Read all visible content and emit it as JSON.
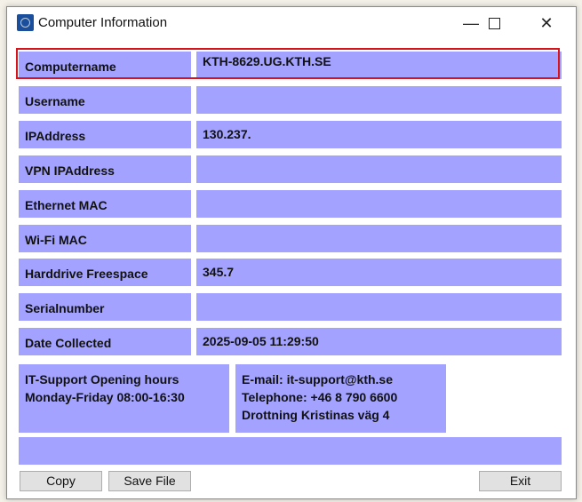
{
  "window": {
    "title": "Computer Information"
  },
  "fields": [
    {
      "label": "Computername",
      "value": "KTH-8629.UG.KTH.SE"
    },
    {
      "label": "Username",
      "value": ""
    },
    {
      "label": "IPAddress",
      "value": "130.237."
    },
    {
      "label": "VPN IPAddress",
      "value": ""
    },
    {
      "label": "Ethernet MAC",
      "value": ""
    },
    {
      "label": "Wi-Fi MAC",
      "value": ""
    },
    {
      "label": "Harddrive Freespace",
      "value": "345.7"
    },
    {
      "label": "Serialnumber",
      "value": ""
    },
    {
      "label": "Date Collected",
      "value": "2025-09-05 11:29:50"
    }
  ],
  "support": {
    "hours_title": "IT-Support Opening hours",
    "hours": "Monday-Friday 08:00-16:30",
    "email": "E-mail: it-support@kth.se",
    "phone": "Telephone: +46 8 790 6600",
    "address": "Drottning Kristinas väg 4"
  },
  "status": "",
  "buttons": {
    "copy": "Copy",
    "save": "Save File",
    "exit": "Exit"
  },
  "colors": {
    "panel": "#a3a3ff",
    "highlight": "#d5141b"
  }
}
